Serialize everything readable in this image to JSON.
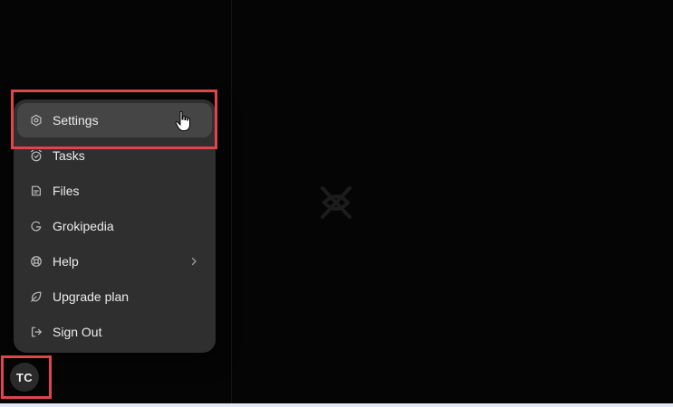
{
  "menu": {
    "items": [
      {
        "label": "Settings",
        "icon": "gear-icon"
      },
      {
        "label": "Tasks",
        "icon": "alarm-clock-icon"
      },
      {
        "label": "Files",
        "icon": "file-icon"
      },
      {
        "label": "Grokipedia",
        "icon": "grokipedia-g-icon"
      },
      {
        "label": "Help",
        "icon": "lifebuoy-icon",
        "has_submenu": true
      },
      {
        "label": "Upgrade plan",
        "icon": "leaf-icon"
      },
      {
        "label": "Sign Out",
        "icon": "sign-out-icon"
      }
    ]
  },
  "user": {
    "initials": "TC"
  },
  "colors": {
    "background": "#050505",
    "menu_bg": "#2f2f2f",
    "menu_active_bg": "#454545",
    "highlight": "#e0454a",
    "text": "#ececec"
  }
}
